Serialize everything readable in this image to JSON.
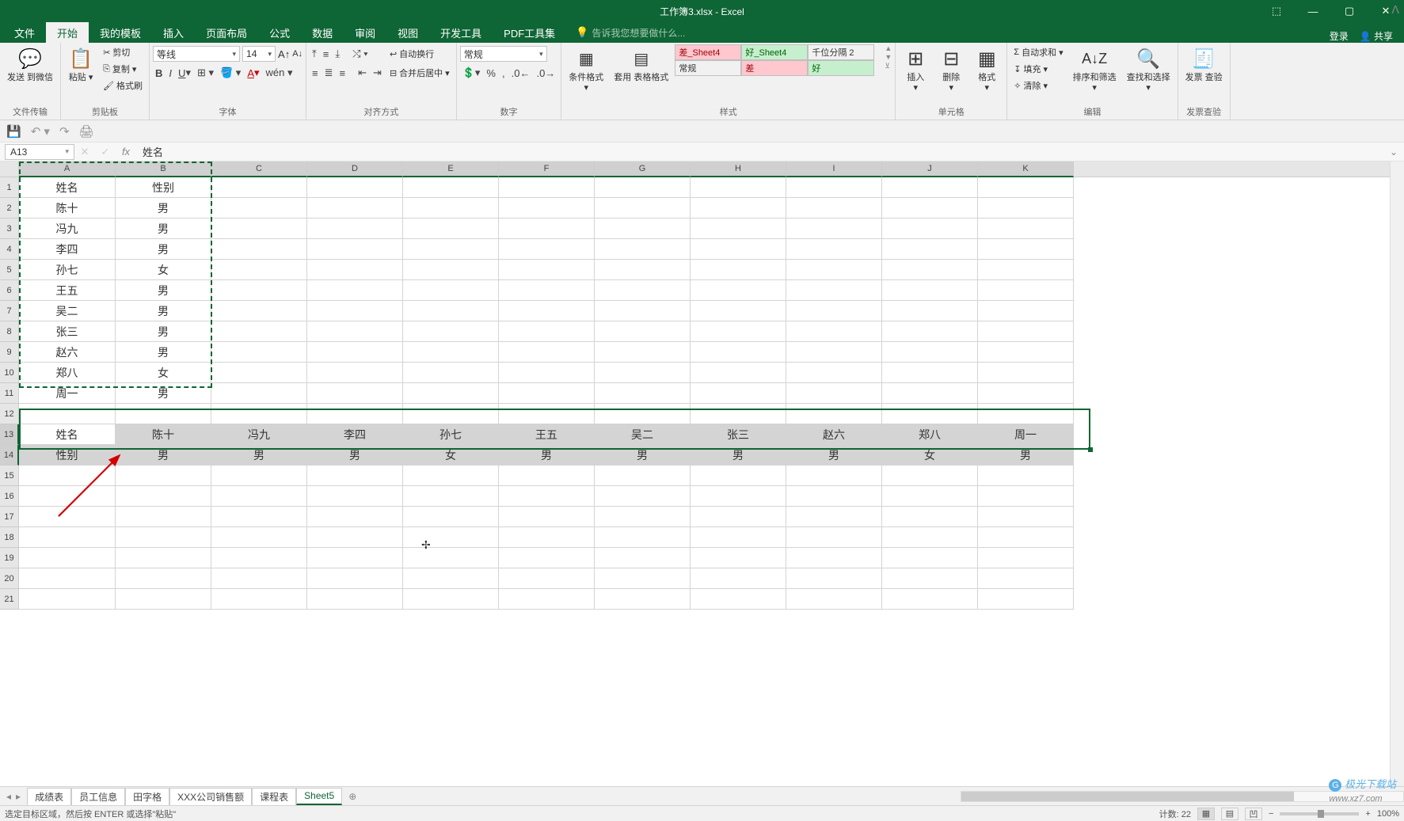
{
  "title": "工作簿3.xlsx - Excel",
  "winctrl": {
    "ribbonopts": "⬚",
    "min": "—",
    "max": "▢",
    "close": "✕",
    "login": "登录",
    "share": "共享"
  },
  "tabs": [
    "文件",
    "开始",
    "我的模板",
    "插入",
    "页面布局",
    "公式",
    "数据",
    "审阅",
    "视图",
    "开发工具",
    "PDF工具集"
  ],
  "active_tab_index": 1,
  "tell_me": "告诉我您想要做什么...",
  "ribbon": {
    "filetrans": {
      "send": "发送\n到微信",
      "label": "文件传输"
    },
    "clipboard": {
      "paste": "粘贴",
      "cut": "剪切",
      "copy": "复制",
      "format": "格式刷",
      "label": "剪贴板"
    },
    "font": {
      "name": "等线",
      "size": "14",
      "label": "字体"
    },
    "align": {
      "wrap": "自动换行",
      "merge": "合并后居中",
      "label": "对齐方式"
    },
    "number": {
      "fmt": "常规",
      "label": "数字"
    },
    "styles": {
      "cond": "条件格式",
      "tbl": "套用\n表格格式",
      "cs1": "差_Sheet4",
      "cs2": "好_Sheet4",
      "cs3": "千位分隔 2",
      "cs4": "常规",
      "cs5": "差",
      "cs6": "好",
      "label": "样式"
    },
    "cells": {
      "insert": "插入",
      "delete": "删除",
      "format": "格式",
      "label": "单元格"
    },
    "editing": {
      "sum": "自动求和",
      "fill": "填充",
      "clear": "清除",
      "sort": "排序和筛选",
      "find": "查找和选择",
      "label": "编辑"
    },
    "invoice": {
      "check": "发票\n查验",
      "label": "发票查验"
    }
  },
  "namebox": "A13",
  "formula": "姓名",
  "colheaders": [
    "A",
    "B",
    "C",
    "D",
    "E",
    "F",
    "G",
    "H",
    "I",
    "J",
    "K"
  ],
  "rows_total": 21,
  "data_block": [
    [
      "姓名",
      "性别"
    ],
    [
      "陈十",
      "男"
    ],
    [
      "冯九",
      "男"
    ],
    [
      "李四",
      "男"
    ],
    [
      "孙七",
      "女"
    ],
    [
      "王五",
      "男"
    ],
    [
      "吴二",
      "男"
    ],
    [
      "张三",
      "男"
    ],
    [
      "赵六",
      "男"
    ],
    [
      "郑八",
      "女"
    ],
    [
      "周一",
      "男"
    ]
  ],
  "transposed": [
    [
      "姓名",
      "陈十",
      "冯九",
      "李四",
      "孙七",
      "王五",
      "吴二",
      "张三",
      "赵六",
      "郑八",
      "周一"
    ],
    [
      "性别",
      "男",
      "男",
      "男",
      "女",
      "男",
      "男",
      "男",
      "男",
      "女",
      "男"
    ]
  ],
  "sheets": [
    "成绩表",
    "员工信息",
    "田字格",
    "XXX公司销售额",
    "课程表",
    "Sheet5"
  ],
  "active_sheet_index": 5,
  "status_msg": "选定目标区域，然后按 ENTER 或选择\"粘贴\"",
  "count": "计数: 22",
  "zoom": "100%",
  "watermark": "极光下载站"
}
